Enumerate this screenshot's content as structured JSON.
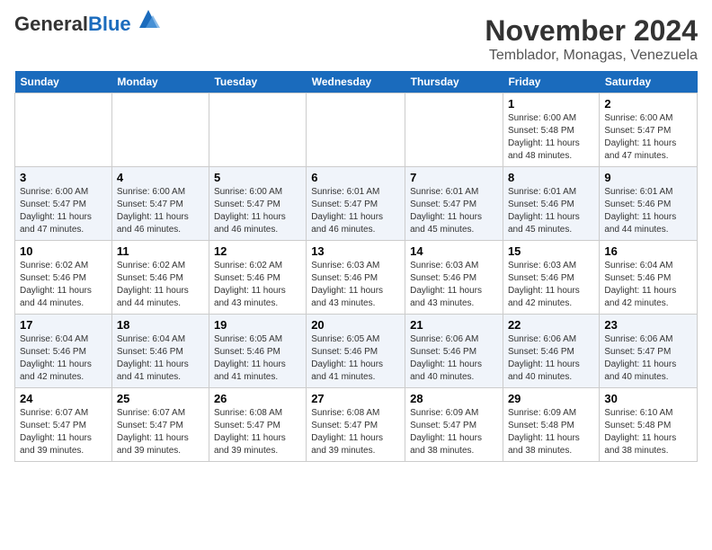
{
  "logo": {
    "general": "General",
    "blue": "Blue"
  },
  "title": "November 2024",
  "location": "Temblador, Monagas, Venezuela",
  "weekdays": [
    "Sunday",
    "Monday",
    "Tuesday",
    "Wednesday",
    "Thursday",
    "Friday",
    "Saturday"
  ],
  "weeks": [
    [
      {
        "day": "",
        "info": ""
      },
      {
        "day": "",
        "info": ""
      },
      {
        "day": "",
        "info": ""
      },
      {
        "day": "",
        "info": ""
      },
      {
        "day": "",
        "info": ""
      },
      {
        "day": "1",
        "info": "Sunrise: 6:00 AM\nSunset: 5:48 PM\nDaylight: 11 hours and 48 minutes."
      },
      {
        "day": "2",
        "info": "Sunrise: 6:00 AM\nSunset: 5:47 PM\nDaylight: 11 hours and 47 minutes."
      }
    ],
    [
      {
        "day": "3",
        "info": "Sunrise: 6:00 AM\nSunset: 5:47 PM\nDaylight: 11 hours and 47 minutes."
      },
      {
        "day": "4",
        "info": "Sunrise: 6:00 AM\nSunset: 5:47 PM\nDaylight: 11 hours and 46 minutes."
      },
      {
        "day": "5",
        "info": "Sunrise: 6:00 AM\nSunset: 5:47 PM\nDaylight: 11 hours and 46 minutes."
      },
      {
        "day": "6",
        "info": "Sunrise: 6:01 AM\nSunset: 5:47 PM\nDaylight: 11 hours and 46 minutes."
      },
      {
        "day": "7",
        "info": "Sunrise: 6:01 AM\nSunset: 5:47 PM\nDaylight: 11 hours and 45 minutes."
      },
      {
        "day": "8",
        "info": "Sunrise: 6:01 AM\nSunset: 5:46 PM\nDaylight: 11 hours and 45 minutes."
      },
      {
        "day": "9",
        "info": "Sunrise: 6:01 AM\nSunset: 5:46 PM\nDaylight: 11 hours and 44 minutes."
      }
    ],
    [
      {
        "day": "10",
        "info": "Sunrise: 6:02 AM\nSunset: 5:46 PM\nDaylight: 11 hours and 44 minutes."
      },
      {
        "day": "11",
        "info": "Sunrise: 6:02 AM\nSunset: 5:46 PM\nDaylight: 11 hours and 44 minutes."
      },
      {
        "day": "12",
        "info": "Sunrise: 6:02 AM\nSunset: 5:46 PM\nDaylight: 11 hours and 43 minutes."
      },
      {
        "day": "13",
        "info": "Sunrise: 6:03 AM\nSunset: 5:46 PM\nDaylight: 11 hours and 43 minutes."
      },
      {
        "day": "14",
        "info": "Sunrise: 6:03 AM\nSunset: 5:46 PM\nDaylight: 11 hours and 43 minutes."
      },
      {
        "day": "15",
        "info": "Sunrise: 6:03 AM\nSunset: 5:46 PM\nDaylight: 11 hours and 42 minutes."
      },
      {
        "day": "16",
        "info": "Sunrise: 6:04 AM\nSunset: 5:46 PM\nDaylight: 11 hours and 42 minutes."
      }
    ],
    [
      {
        "day": "17",
        "info": "Sunrise: 6:04 AM\nSunset: 5:46 PM\nDaylight: 11 hours and 42 minutes."
      },
      {
        "day": "18",
        "info": "Sunrise: 6:04 AM\nSunset: 5:46 PM\nDaylight: 11 hours and 41 minutes."
      },
      {
        "day": "19",
        "info": "Sunrise: 6:05 AM\nSunset: 5:46 PM\nDaylight: 11 hours and 41 minutes."
      },
      {
        "day": "20",
        "info": "Sunrise: 6:05 AM\nSunset: 5:46 PM\nDaylight: 11 hours and 41 minutes."
      },
      {
        "day": "21",
        "info": "Sunrise: 6:06 AM\nSunset: 5:46 PM\nDaylight: 11 hours and 40 minutes."
      },
      {
        "day": "22",
        "info": "Sunrise: 6:06 AM\nSunset: 5:46 PM\nDaylight: 11 hours and 40 minutes."
      },
      {
        "day": "23",
        "info": "Sunrise: 6:06 AM\nSunset: 5:47 PM\nDaylight: 11 hours and 40 minutes."
      }
    ],
    [
      {
        "day": "24",
        "info": "Sunrise: 6:07 AM\nSunset: 5:47 PM\nDaylight: 11 hours and 39 minutes."
      },
      {
        "day": "25",
        "info": "Sunrise: 6:07 AM\nSunset: 5:47 PM\nDaylight: 11 hours and 39 minutes."
      },
      {
        "day": "26",
        "info": "Sunrise: 6:08 AM\nSunset: 5:47 PM\nDaylight: 11 hours and 39 minutes."
      },
      {
        "day": "27",
        "info": "Sunrise: 6:08 AM\nSunset: 5:47 PM\nDaylight: 11 hours and 39 minutes."
      },
      {
        "day": "28",
        "info": "Sunrise: 6:09 AM\nSunset: 5:47 PM\nDaylight: 11 hours and 38 minutes."
      },
      {
        "day": "29",
        "info": "Sunrise: 6:09 AM\nSunset: 5:48 PM\nDaylight: 11 hours and 38 minutes."
      },
      {
        "day": "30",
        "info": "Sunrise: 6:10 AM\nSunset: 5:48 PM\nDaylight: 11 hours and 38 minutes."
      }
    ]
  ]
}
